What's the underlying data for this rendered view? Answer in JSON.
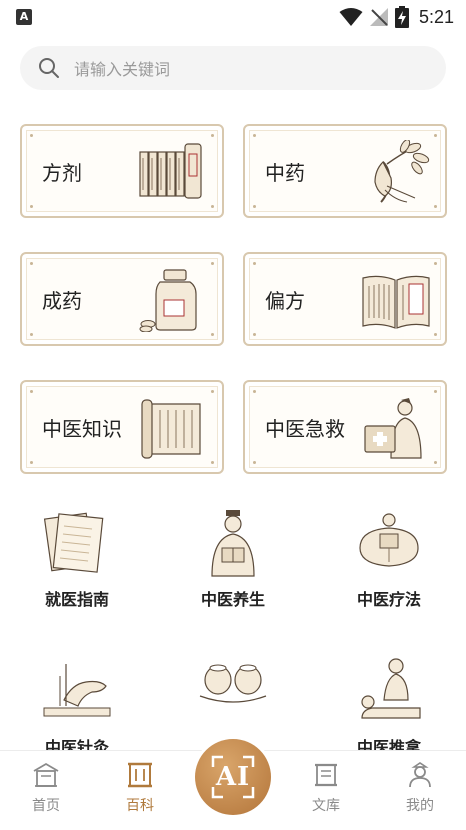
{
  "status_bar": {
    "app_icon_letter": "A",
    "time": "5:21"
  },
  "search": {
    "placeholder": "请输入关键词"
  },
  "cards": [
    {
      "label": "方剂",
      "illustration": "scroll-bundle-icon"
    },
    {
      "label": "中药",
      "illustration": "ginseng-icon"
    },
    {
      "label": "成药",
      "illustration": "medicine-bottle-icon"
    },
    {
      "label": "偏方",
      "illustration": "open-book-icon"
    },
    {
      "label": "中医知识",
      "illustration": "bamboo-scroll-icon"
    },
    {
      "label": "中医急救",
      "illustration": "doctor-firstaid-icon"
    }
  ],
  "grid": [
    {
      "label": "就医指南",
      "illustration": "paper-stack-icon"
    },
    {
      "label": "中医养生",
      "illustration": "scholar-reading-icon"
    },
    {
      "label": "中医疗法",
      "illustration": "back-treatment-icon"
    },
    {
      "label": "中医针灸",
      "illustration": "acupuncture-icon"
    },
    {
      "label": "",
      "illustration": "cupping-icon"
    },
    {
      "label": "中医推拿",
      "illustration": "massage-icon"
    }
  ],
  "bottom_nav": {
    "items": [
      {
        "label": "首页",
        "icon": "home-icon"
      },
      {
        "label": "百科",
        "icon": "encyclopedia-icon",
        "active": true
      },
      {
        "label": "文库",
        "icon": "library-icon"
      },
      {
        "label": "我的",
        "icon": "profile-icon"
      }
    ],
    "ai_label": "AI"
  },
  "colors": {
    "accent": "#b07a3c",
    "card_border": "#d8c8ae",
    "inactive": "#8a8a8a"
  }
}
